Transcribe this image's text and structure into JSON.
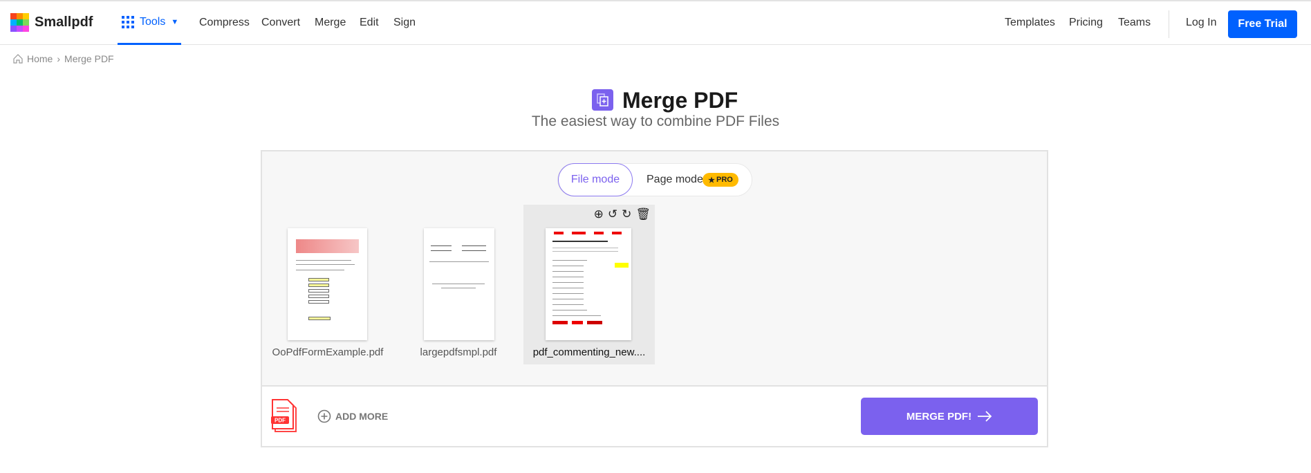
{
  "header": {
    "brand": "Smallpdf",
    "tools_label": "Tools",
    "nav_left": [
      "Compress",
      "Convert",
      "Merge",
      "Edit",
      "Sign"
    ],
    "nav_right": [
      "Templates",
      "Pricing",
      "Teams"
    ],
    "login": "Log In",
    "free_trial": "Free Trial",
    "accent_color": "#0061fe"
  },
  "breadcrumb": {
    "home": "Home",
    "separator": "›",
    "current": "Merge PDF"
  },
  "hero": {
    "title": "Merge PDF",
    "subtitle": "The easiest way to combine PDF Files",
    "icon": "merge-files-icon",
    "color": "#7b61ee"
  },
  "modes": {
    "file_mode": "File mode",
    "page_mode": "Page mode",
    "pro_badge": "PRO",
    "selected": "File mode"
  },
  "files": [
    {
      "name": "OoPdfFormExample.pdf",
      "selected": false
    },
    {
      "name": "largepdfsmpl.pdf",
      "selected": false
    },
    {
      "name": "pdf_commenting_new....",
      "selected": true
    }
  ],
  "file_actions": [
    "zoom-in-icon",
    "rotate-left-icon",
    "rotate-right-icon",
    "trash-icon"
  ],
  "bottom": {
    "add_more": "ADD MORE",
    "merge_button": "MERGE PDF!"
  }
}
